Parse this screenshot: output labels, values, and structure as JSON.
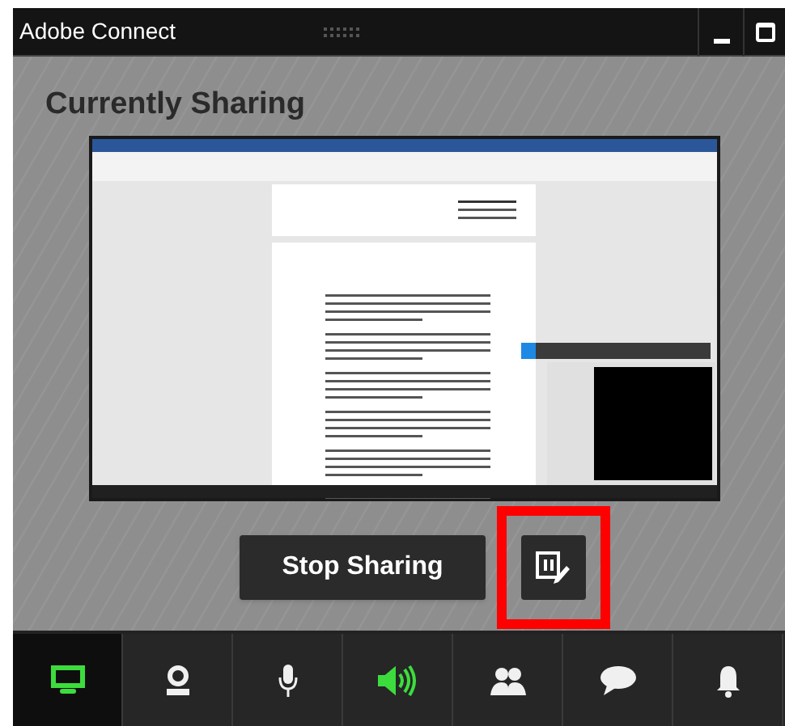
{
  "window": {
    "title": "Adobe Connect"
  },
  "panel": {
    "heading": "Currently Sharing",
    "stop_button": "Stop Sharing",
    "pause_highlighted": true
  },
  "toolbar": [
    {
      "kind": "screen",
      "selected": true,
      "on": true
    },
    {
      "kind": "camera",
      "selected": false,
      "on": false
    },
    {
      "kind": "mic",
      "selected": false,
      "on": false
    },
    {
      "kind": "speaker",
      "selected": false,
      "on": true
    },
    {
      "kind": "attendees",
      "selected": false,
      "on": false
    },
    {
      "kind": "chat",
      "selected": false,
      "on": false
    },
    {
      "kind": "notifications",
      "selected": false,
      "on": false
    }
  ]
}
